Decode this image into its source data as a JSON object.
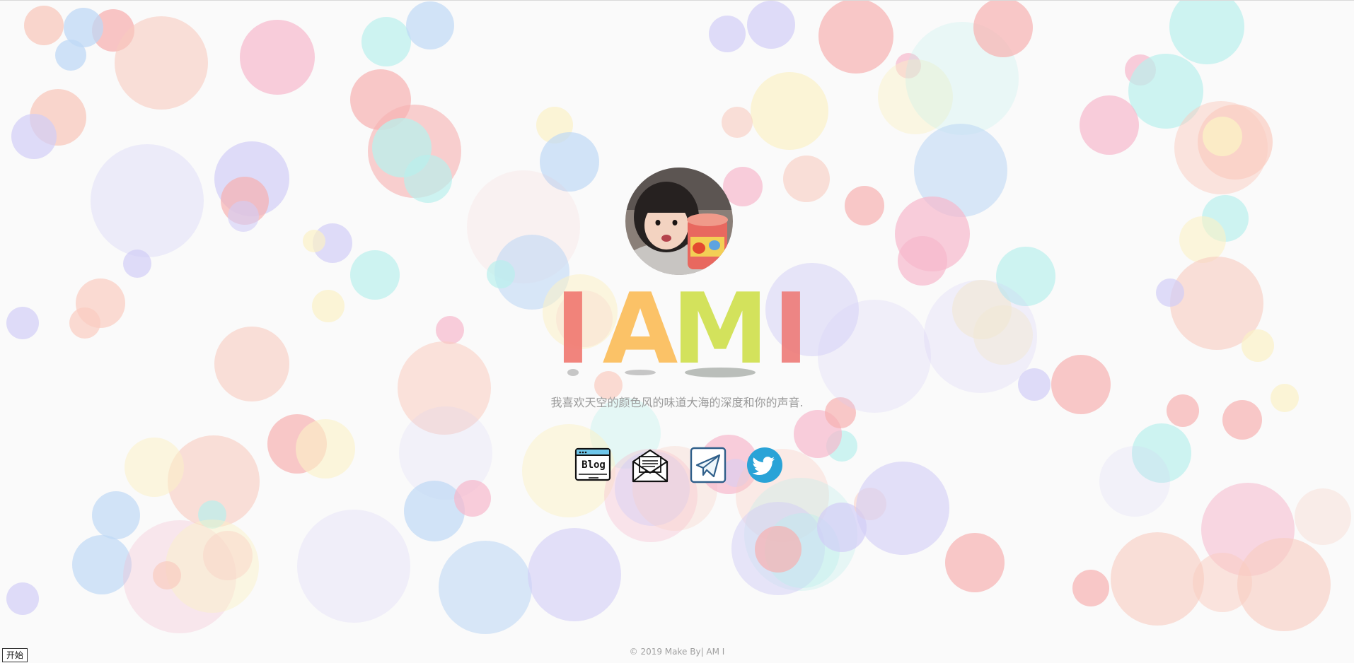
{
  "hero": {
    "title_letters": [
      "I",
      "A",
      "M",
      "I"
    ],
    "subtitle": "我喜欢天空的颜色风的味道大海的深度和你的声音."
  },
  "links": [
    {
      "icon": "blog-icon",
      "label": "Blog"
    },
    {
      "icon": "mail-icon"
    },
    {
      "icon": "telegram-icon"
    },
    {
      "icon": "twitter-icon"
    }
  ],
  "footer": {
    "copyright": "© 2019 Make By| AM I"
  },
  "controls": {
    "start_label": "开始"
  },
  "colors": {
    "background": "#fafafa",
    "letter_1": "#f07a72",
    "letter_2": "#fbbd5a",
    "letter_3": "#cfe04e",
    "letter_4": "#ee7d7a",
    "twitter": "#2aa3d7",
    "bubble_pink": "#f6b8cc",
    "bubble_peach": "#f9ccc0",
    "bubble_cyan": "#b9f0ec",
    "bubble_blue": "#bfd8f5",
    "bubble_lavender": "#d2cdf6",
    "bubble_yellow": "#fbf1c6",
    "bubble_red": "#f7b1b1"
  }
}
